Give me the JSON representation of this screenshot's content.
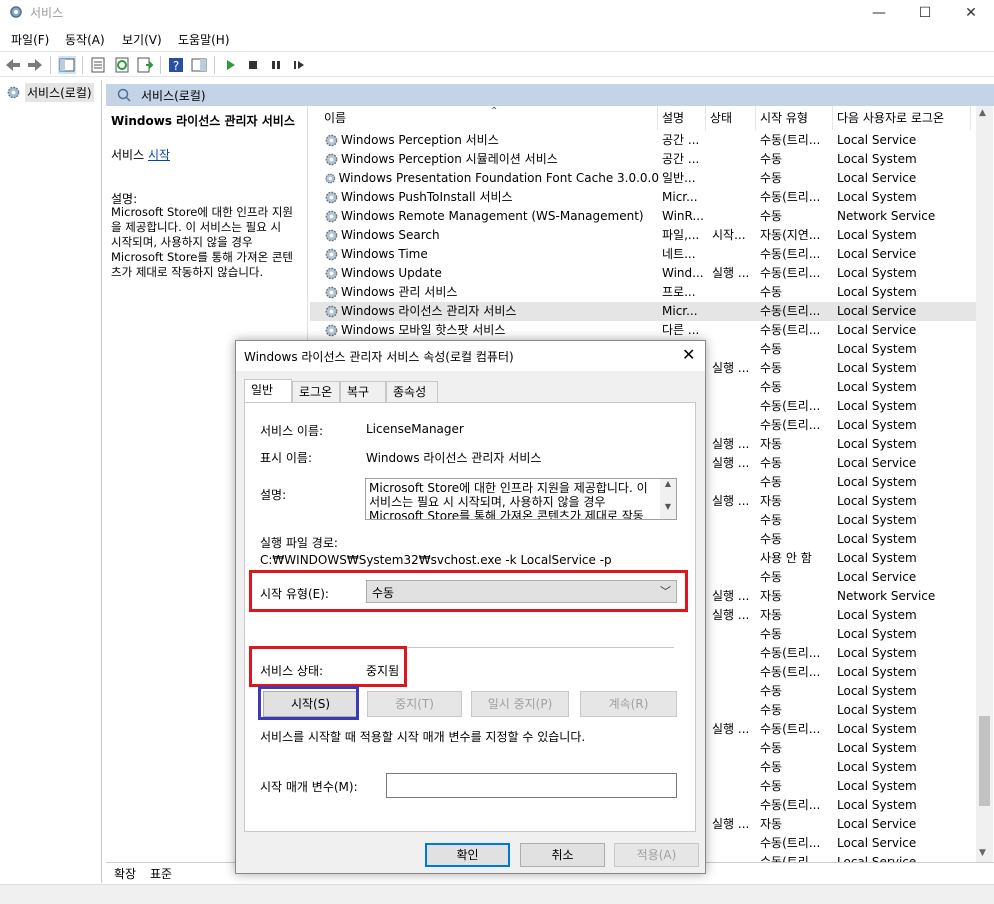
{
  "window": {
    "title": "서비스",
    "controls": [
      "—",
      "☐",
      "✕"
    ]
  },
  "menu": [
    "파일(F)",
    "동작(A)",
    "보기(V)",
    "도움말(H)"
  ],
  "tree": {
    "root_label": "서비스(로컬)"
  },
  "pane_header": "서비스(로컬)",
  "details": {
    "service_title": "Windows 라이선스 관리자 서비스",
    "start_prefix": "서비스 ",
    "start_link": "시작",
    "description_label": "설명:",
    "description_lines": [
      "Microsoft Store에 대한 인프라 지원",
      "을 제공합니다. 이 서비스는 필요 시",
      "시작되며, 사용하지 않을 경우",
      "Microsoft Store를 통해 가져온 콘텐",
      "츠가 제대로 작동하지 않습니다."
    ]
  },
  "columns": {
    "name": "이름",
    "description": "설명",
    "status": "상태",
    "startup_type": "시작 유형",
    "log_on_as": "다음 사용자로 로그온"
  },
  "rows": [
    {
      "name": "Windows Perception 서비스",
      "desc": "공간 ...",
      "state": "",
      "start": "수동(트리...",
      "logon": "Local Service"
    },
    {
      "name": "Windows Perception 시뮬레이션 서비스",
      "desc": "공간 ...",
      "state": "",
      "start": "수동",
      "logon": "Local System"
    },
    {
      "name": "Windows Presentation Foundation Font Cache 3.0.0.0",
      "desc": "일반...",
      "state": "",
      "start": "수동",
      "logon": "Local Service"
    },
    {
      "name": "Windows PushToInstall 서비스",
      "desc": "Micr...",
      "state": "",
      "start": "수동(트리...",
      "logon": "Local System"
    },
    {
      "name": "Windows Remote Management (WS-Management)",
      "desc": "WinR...",
      "state": "",
      "start": "수동",
      "logon": "Network Service"
    },
    {
      "name": "Windows Search",
      "desc": "파일,...",
      "state": "시작...",
      "start": "자동(지연...",
      "logon": "Local System"
    },
    {
      "name": "Windows Time",
      "desc": "네트...",
      "state": "",
      "start": "수동(트리...",
      "logon": "Local Service"
    },
    {
      "name": "Windows Update",
      "desc": "Wind...",
      "state": "실행 ...",
      "start": "수동(트리...",
      "logon": "Local System"
    },
    {
      "name": "Windows 관리 서비스",
      "desc": "프로...",
      "state": "",
      "start": "수동",
      "logon": "Local System"
    },
    {
      "name": "Windows 라이선스 관리자 서비스",
      "desc": "Micr...",
      "state": "",
      "start": "수동(트리...",
      "logon": "Local Service",
      "selected": true
    },
    {
      "name": "Windows 모바일 핫스팟 서비스",
      "desc": "다른 ...",
      "state": "",
      "start": "수동(트리...",
      "logon": "Local Service"
    },
    {
      "name": "",
      "desc": "",
      "state": "",
      "start": "수동",
      "logon": "Local System"
    },
    {
      "name": "",
      "desc": "",
      "state": "실행 ...",
      "start": "수동",
      "logon": "Local System"
    },
    {
      "name": "",
      "desc": "",
      "state": "",
      "start": "수동",
      "logon": "Local System"
    },
    {
      "name": "",
      "desc": "",
      "state": "",
      "start": "수동(트리...",
      "logon": "Local System"
    },
    {
      "name": "",
      "desc": "",
      "state": "",
      "start": "수동(트리...",
      "logon": "Local System"
    },
    {
      "name": "",
      "desc": "",
      "state": "실행 ...",
      "start": "자동",
      "logon": "Local System"
    },
    {
      "name": "",
      "desc": "",
      "state": "실행 ...",
      "start": "수동",
      "logon": "Local Service"
    },
    {
      "name": "",
      "desc": "",
      "state": "",
      "start": "수동",
      "logon": "Local System"
    },
    {
      "name": "",
      "desc": "",
      "state": "실행 ...",
      "start": "자동",
      "logon": "Local System"
    },
    {
      "name": "",
      "desc": "",
      "state": "",
      "start": "수동",
      "logon": "Local System"
    },
    {
      "name": "",
      "desc": "",
      "state": "",
      "start": "수동",
      "logon": "Local System"
    },
    {
      "name": "",
      "desc": "",
      "state": "",
      "start": "사용 안 함",
      "logon": "Local System"
    },
    {
      "name": "",
      "desc": "",
      "state": "",
      "start": "수동",
      "logon": "Local Service"
    },
    {
      "name": "",
      "desc": "",
      "state": "실행 ...",
      "start": "자동",
      "logon": "Network Service"
    },
    {
      "name": "",
      "desc": "",
      "state": "실행 ...",
      "start": "자동",
      "logon": "Local System"
    },
    {
      "name": "",
      "desc": "",
      "state": "",
      "start": "수동",
      "logon": "Local System"
    },
    {
      "name": "",
      "desc": "",
      "state": "",
      "start": "수동(트리...",
      "logon": "Local System"
    },
    {
      "name": "",
      "desc": "",
      "state": "",
      "start": "수동(트리...",
      "logon": "Local System"
    },
    {
      "name": "",
      "desc": "",
      "state": "",
      "start": "수동",
      "logon": "Local System"
    },
    {
      "name": "",
      "desc": "",
      "state": "",
      "start": "수동",
      "logon": "Local System"
    },
    {
      "name": "",
      "desc": "",
      "state": "실행 ...",
      "start": "수동(트리...",
      "logon": "Local System"
    },
    {
      "name": "",
      "desc": "",
      "state": "",
      "start": "수동",
      "logon": "Local System"
    },
    {
      "name": "",
      "desc": "",
      "state": "",
      "start": "수동",
      "logon": "Local System"
    },
    {
      "name": "",
      "desc": "",
      "state": "",
      "start": "수동",
      "logon": "Local System"
    },
    {
      "name": "",
      "desc": "",
      "state": "",
      "start": "수동(트리...",
      "logon": "Local System"
    },
    {
      "name": "",
      "desc": "",
      "state": "실행 ...",
      "start": "자동",
      "logon": "Local Service"
    },
    {
      "name": "",
      "desc": "",
      "state": "",
      "start": "수동(트리...",
      "logon": "Local Service"
    },
    {
      "name": "",
      "desc": "",
      "state": "",
      "start": "수동(트리...",
      "logon": "Local Service"
    }
  ],
  "bottom_tabs": [
    "확장",
    "표준"
  ],
  "dialog": {
    "title": "Windows 라이선스 관리자 서비스 속성(로컬 컴퓨터)",
    "close": "✕",
    "tabs": [
      "일반",
      "로그온",
      "복구",
      "종속성"
    ],
    "service_name_label": "서비스 이름:",
    "service_name": "LicenseManager",
    "display_name_label": "표시 이름:",
    "display_name": "Windows 라이선스 관리자 서비스",
    "description_label": "설명:",
    "description_lines": [
      "Microsoft Store에 대한 인프라 지원을 제공합니다. 이",
      "서비스는 필요 시 시작되며, 사용하지 않을 경우",
      "Microsoft Store를 통해 가져온 콘텐츠가 제대로 작동"
    ],
    "path_label": "실행 파일 경로:",
    "path": "C:₩WINDOWS₩System32₩svchost.exe -k LocalService -p",
    "startup_type_label": "시작 유형(E):",
    "startup_type_value": "수동",
    "status_label": "서비스 상태:",
    "status_value": "중지됨",
    "btn_start": "시작(S)",
    "btn_stop": "중지(T)",
    "btn_pause": "일시 중지(P)",
    "btn_resume": "계속(R)",
    "hint": "서비스를 시작할 때 적용할 시작 매개 변수를 지정할 수 있습니다.",
    "param_label": "시작 매개 변수(M):",
    "param_value": "",
    "btn_ok": "확인",
    "btn_cancel": "취소",
    "btn_apply": "적용(A)"
  },
  "colors": {
    "annotation_red": "#e0161e",
    "annotation_blue": "#3b3bb8",
    "pane_header_bg": "#c4d3e6",
    "selected_row_bg": "#e5e5e5"
  },
  "icons": [
    "services-gear-icon",
    "back-arrow-icon",
    "forward-arrow-icon",
    "play-icon",
    "stop-icon",
    "pause-icon",
    "restart-icon",
    "help-icon"
  ]
}
